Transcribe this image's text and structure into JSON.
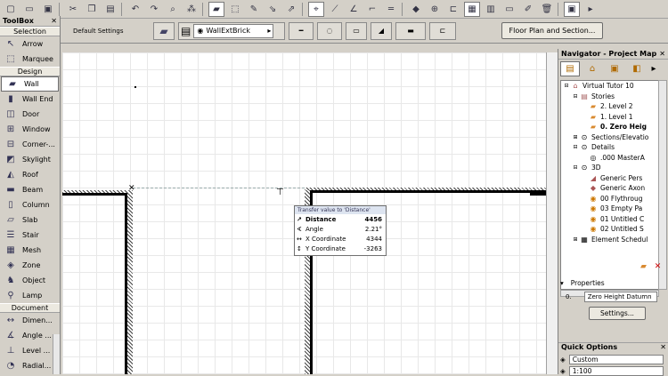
{
  "toolbox": {
    "title": "ToolBox",
    "sections": {
      "selection": "Selection",
      "design": "Design",
      "document": "Document"
    },
    "selection_tools": [
      {
        "label": "Arrow",
        "icon": "arrow-icon"
      },
      {
        "label": "Marquee",
        "icon": "marquee-icon"
      }
    ],
    "design_tools": [
      {
        "label": "Wall",
        "icon": "wall-icon"
      },
      {
        "label": "Wall End",
        "icon": "wall-end-icon"
      },
      {
        "label": "Door",
        "icon": "door-icon"
      },
      {
        "label": "Window",
        "icon": "window-icon"
      },
      {
        "label": "Corner-...",
        "icon": "corner-window-icon"
      },
      {
        "label": "Skylight",
        "icon": "skylight-icon"
      },
      {
        "label": "Roof",
        "icon": "roof-icon"
      },
      {
        "label": "Beam",
        "icon": "beam-icon"
      },
      {
        "label": "Column",
        "icon": "column-icon"
      },
      {
        "label": "Slab",
        "icon": "slab-icon"
      },
      {
        "label": "Stair",
        "icon": "stair-icon"
      },
      {
        "label": "Mesh",
        "icon": "mesh-icon"
      },
      {
        "label": "Zone",
        "icon": "zone-icon"
      },
      {
        "label": "Object",
        "icon": "object-icon"
      },
      {
        "label": "Lamp",
        "icon": "lamp-icon"
      }
    ],
    "document_tools": [
      {
        "label": "Dimen...",
        "icon": "dimension-icon"
      },
      {
        "label": "Angle ...",
        "icon": "angle-dimension-icon"
      },
      {
        "label": "Level ...",
        "icon": "level-dimension-icon"
      },
      {
        "label": "Radial...",
        "icon": "radial-dimension-icon"
      }
    ]
  },
  "infobox": {
    "label": "Default Settings",
    "wall_type": "WallExtBrick",
    "view_button": "Floor Plan and Section..."
  },
  "tracker": {
    "header": "Transfer value to 'Distance'",
    "rows": [
      {
        "label": "Distance",
        "value": "4456"
      },
      {
        "label": "Angle",
        "value": "2.21°"
      },
      {
        "label": "X Coordinate",
        "value": "4344"
      },
      {
        "label": "Y Coordinate",
        "value": "-3263"
      }
    ]
  },
  "navigator": {
    "title": "Navigator - Project Map",
    "tree": [
      {
        "label": "Virtual Tutor 10",
        "level": 0
      },
      {
        "label": "Stories",
        "level": 1
      },
      {
        "label": "2. Level 2",
        "level": 2
      },
      {
        "label": "1. Level 1",
        "level": 2
      },
      {
        "label": "0. Zero Heig",
        "level": 2,
        "bold": true
      },
      {
        "label": "Sections/Elevatio",
        "level": 1
      },
      {
        "label": "Details",
        "level": 1
      },
      {
        "label": ".000 MasterA",
        "level": 2
      },
      {
        "label": "3D",
        "level": 1
      },
      {
        "label": "Generic Pers",
        "level": 2
      },
      {
        "label": "Generic Axon",
        "level": 2
      },
      {
        "label": "00 Flythroug",
        "level": 2
      },
      {
        "label": "03 Empty Pa",
        "level": 2
      },
      {
        "label": "01 Untitled C",
        "level": 2
      },
      {
        "label": "02 Untitled S",
        "level": 2
      },
      {
        "label": "Element Schedul",
        "level": 1
      }
    ],
    "properties_label": "Properties",
    "properties_id": "0.",
    "properties_value": "Zero Height Datumn",
    "settings_button": "Settings..."
  },
  "quick_options": {
    "title": "Quick Options",
    "custom": "Custom",
    "scale": "1:100"
  },
  "colors": {
    "panel": "#d4d0c8",
    "canvas": "#ffffff",
    "folder": "#e0a040"
  }
}
